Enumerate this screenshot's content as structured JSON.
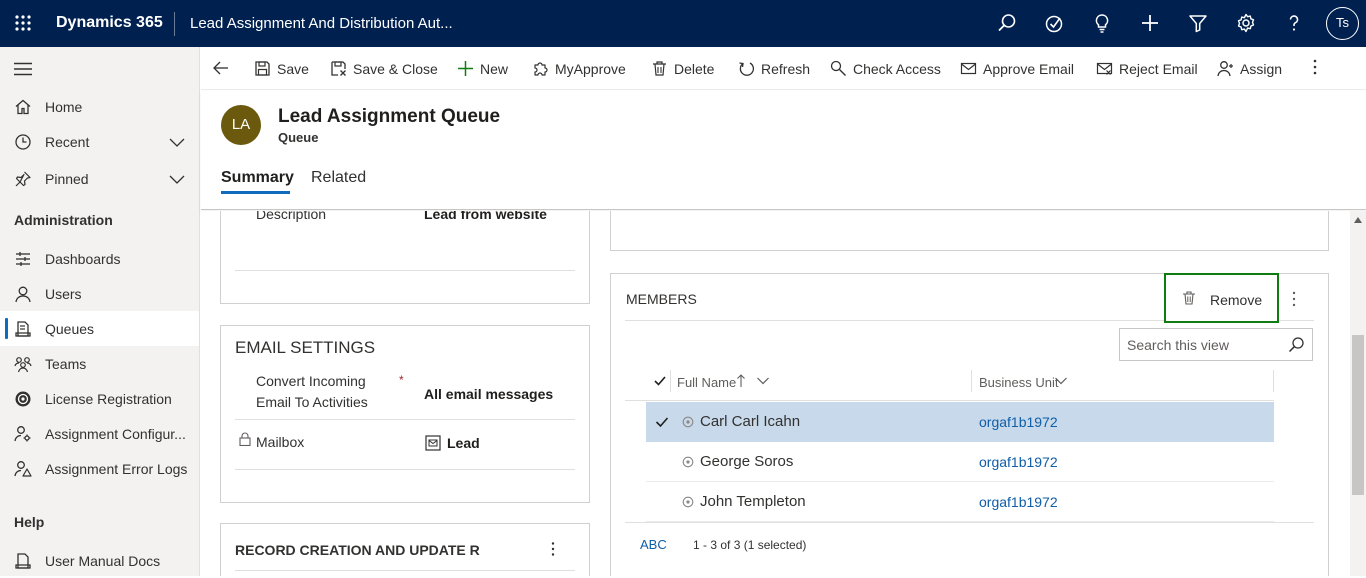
{
  "topbar": {
    "brand": "Dynamics 365",
    "app_title": "Lead Assignment And Distribution Aut...",
    "user_initials": "Ts"
  },
  "sidebar": {
    "items": [
      {
        "label": "Home"
      },
      {
        "label": "Recent"
      },
      {
        "label": "Pinned"
      }
    ],
    "admin_header": "Administration",
    "admin_items": [
      {
        "label": "Dashboards"
      },
      {
        "label": "Users"
      },
      {
        "label": "Queues"
      },
      {
        "label": "Teams"
      },
      {
        "label": "License Registration"
      },
      {
        "label": "Assignment Configur..."
      },
      {
        "label": "Assignment Error Logs"
      }
    ],
    "help_header": "Help",
    "help_items": [
      {
        "label": "User Manual Docs"
      }
    ]
  },
  "commandbar": {
    "save": "Save",
    "save_close": "Save & Close",
    "new": "New",
    "myapprove": "MyApprove",
    "delete": "Delete",
    "refresh": "Refresh",
    "check_access": "Check Access",
    "approve_email": "Approve Email",
    "reject_email": "Reject Email",
    "assign": "Assign"
  },
  "record": {
    "avatar_initials": "LA",
    "title": "Lead Assignment Queue",
    "entity": "Queue",
    "tabs": [
      "Summary",
      "Related"
    ]
  },
  "general": {
    "description_label": "Description",
    "description_value": "Lead from website"
  },
  "email_settings": {
    "title": "EMAIL SETTINGS",
    "convert_label_line1": "Convert Incoming",
    "convert_label_line2": "Email To Activities",
    "required_mark": "*",
    "convert_value": "All email messages",
    "mailbox_label": "Mailbox",
    "mailbox_value": "Lead"
  },
  "record_creation": {
    "title": "RECORD CREATION AND UPDATE R"
  },
  "members": {
    "title": "MEMBERS",
    "remove_label": "Remove",
    "search_placeholder": "Search this view",
    "columns": [
      "Full Name",
      "Business Unit"
    ],
    "rows": [
      {
        "name": "Carl Carl Icahn",
        "business_unit": "orgaf1b1972",
        "selected": true
      },
      {
        "name": "George Soros",
        "business_unit": "orgaf1b1972",
        "selected": false
      },
      {
        "name": "John Templeton",
        "business_unit": "orgaf1b1972",
        "selected": false
      }
    ],
    "footer_abc": "ABC",
    "footer_count": "1 - 3 of 3 (1 selected)"
  },
  "colors": {
    "topbar": "#002050",
    "accent": "#0f6cbd",
    "selected_row": "#c7d9ea",
    "highlight_border": "#107c10",
    "avatar": "#6b5a0e"
  }
}
